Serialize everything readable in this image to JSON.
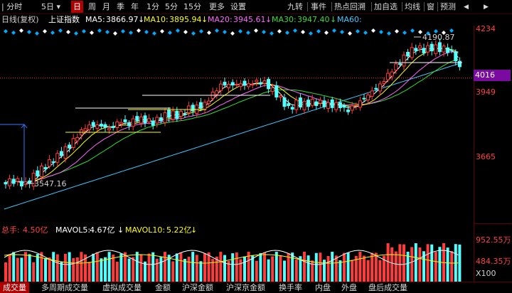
{
  "toolbar": {
    "items": [
      "分时",
      "5日",
      "日",
      "周",
      "月",
      "季",
      "年",
      "1分",
      "5分",
      "15分",
      "更多",
      "设置"
    ],
    "active_index": 2,
    "right_items": [
      "九转",
      "事件",
      "热点回溯",
      "加自选",
      "均线",
      "窗",
      "预测"
    ],
    "dropdown_arrow": "▾"
  },
  "info": {
    "mode": "日线(复权)",
    "name": "上证指数",
    "ma5_label": "MA5:",
    "ma5": "3866.97",
    "ma10_label": "MA10:",
    "ma10": "3895.94",
    "ma20_label": "MA20:",
    "ma20": "3945.61",
    "ma30_label": "MA30:",
    "ma30": "3947.40",
    "ma60_label": "MA60:",
    "down_arrow": "↓"
  },
  "price_axis": {
    "labels": [
      "4234",
      "3949",
      "3665"
    ],
    "current": "4016"
  },
  "annotations": {
    "high": "4190.87",
    "low": "3547.16"
  },
  "volume": {
    "total_label": "总手:",
    "total": "4.50亿",
    "mavol5_label": "MAVOL5:",
    "mavol5": "4.67亿",
    "mavol10_label": "MAVOL10:",
    "mavol10": "5.22亿",
    "axis_top": "952.55万",
    "axis_mid": "484.35万",
    "axis_unit": "X100"
  },
  "bottom_tabs": [
    "成交量",
    "多周期成交量",
    "虚拟成交量",
    "金额",
    "沪深金额",
    "沪深京金额",
    "换手率",
    "内盘",
    "外盘",
    "盘后成交量"
  ],
  "bottom_active": 0,
  "colors": {
    "up": "#ff3c3c",
    "down": "#54ffff",
    "ma5": "#ffffff",
    "ma10": "#ffff00",
    "ma20": "#ff66ff",
    "ma30": "#33dd33",
    "ma60": "#3cc8ff",
    "diamond": "#00aaff"
  }
}
